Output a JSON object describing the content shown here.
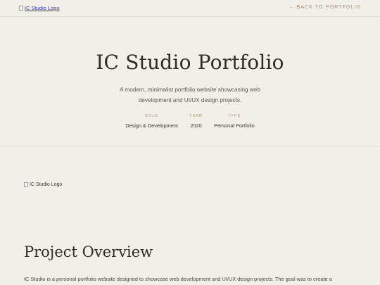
{
  "header": {
    "logo_alt": "IC Studio Logo",
    "back_link": "← BACK TO PORTFOLIO"
  },
  "hero": {
    "title": "IC Studio Portfolio",
    "description": "A modern, minimalist portfolio website showcasing web development and UI/UX design projects.",
    "meta": [
      {
        "label": "ROLE",
        "value": "Design & Development"
      },
      {
        "label": "YEAR",
        "value": "2020"
      },
      {
        "label": "TYPE",
        "value": "Personal Portfolio"
      }
    ]
  },
  "content": {
    "logo_alt": "IC Studio Logo",
    "section_title": "Project Overview",
    "body_text": "IC Studio is a personal portfolio website designed to showcase web development and UI/UX design projects. The goal was to create a"
  },
  "colors": {
    "background": "#f2efe8",
    "accent": "#b4936b",
    "link": "#2a38c8"
  }
}
